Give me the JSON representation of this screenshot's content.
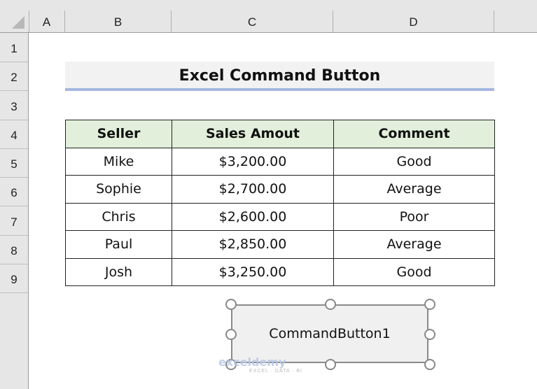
{
  "columns": [
    "A",
    "B",
    "C",
    "D"
  ],
  "rows": [
    "1",
    "2",
    "3",
    "4",
    "5",
    "6",
    "7",
    "8",
    "9"
  ],
  "title": "Excel Command Button",
  "table": {
    "headers": [
      "Seller",
      "Sales Amout",
      "Comment"
    ],
    "rows": [
      [
        "Mike",
        "$3,200.00",
        "Good"
      ],
      [
        "Sophie",
        "$2,700.00",
        "Average"
      ],
      [
        "Chris",
        "$2,600.00",
        "Poor"
      ],
      [
        "Paul",
        "$2,850.00",
        "Average"
      ],
      [
        "Josh",
        "$3,250.00",
        "Good"
      ]
    ]
  },
  "command_button": {
    "label": "CommandButton1"
  },
  "watermark": {
    "brand": "exceldemy",
    "tagline": "EXCEL · DATA · BI"
  }
}
